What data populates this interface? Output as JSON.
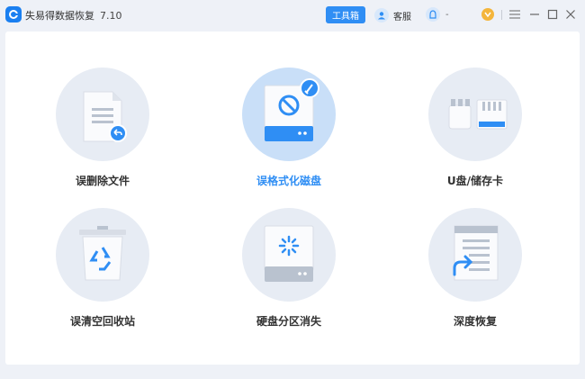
{
  "app": {
    "title": "失易得数据恢复",
    "version": "7.10"
  },
  "titlebar": {
    "toolbox_label": "工具箱",
    "service_label": "客服",
    "account_label": "-"
  },
  "colors": {
    "accent": "#2f8ef4",
    "circle_bg": "#e7ecf4",
    "circle_active": "#c9dff8",
    "window_bg": "#eef1f7"
  },
  "tiles": [
    {
      "label": "误删除文件",
      "icon": "deleted-file-icon",
      "active": false
    },
    {
      "label": "误格式化磁盘",
      "icon": "formatted-disk-icon",
      "active": true
    },
    {
      "label": "U盘/储存卡",
      "icon": "usb-sdcard-icon",
      "active": false
    },
    {
      "label": "误清空回收站",
      "icon": "recycle-bin-icon",
      "active": false
    },
    {
      "label": "硬盘分区消失",
      "icon": "lost-partition-icon",
      "active": false
    },
    {
      "label": "深度恢复",
      "icon": "deep-recovery-icon",
      "active": false
    }
  ]
}
